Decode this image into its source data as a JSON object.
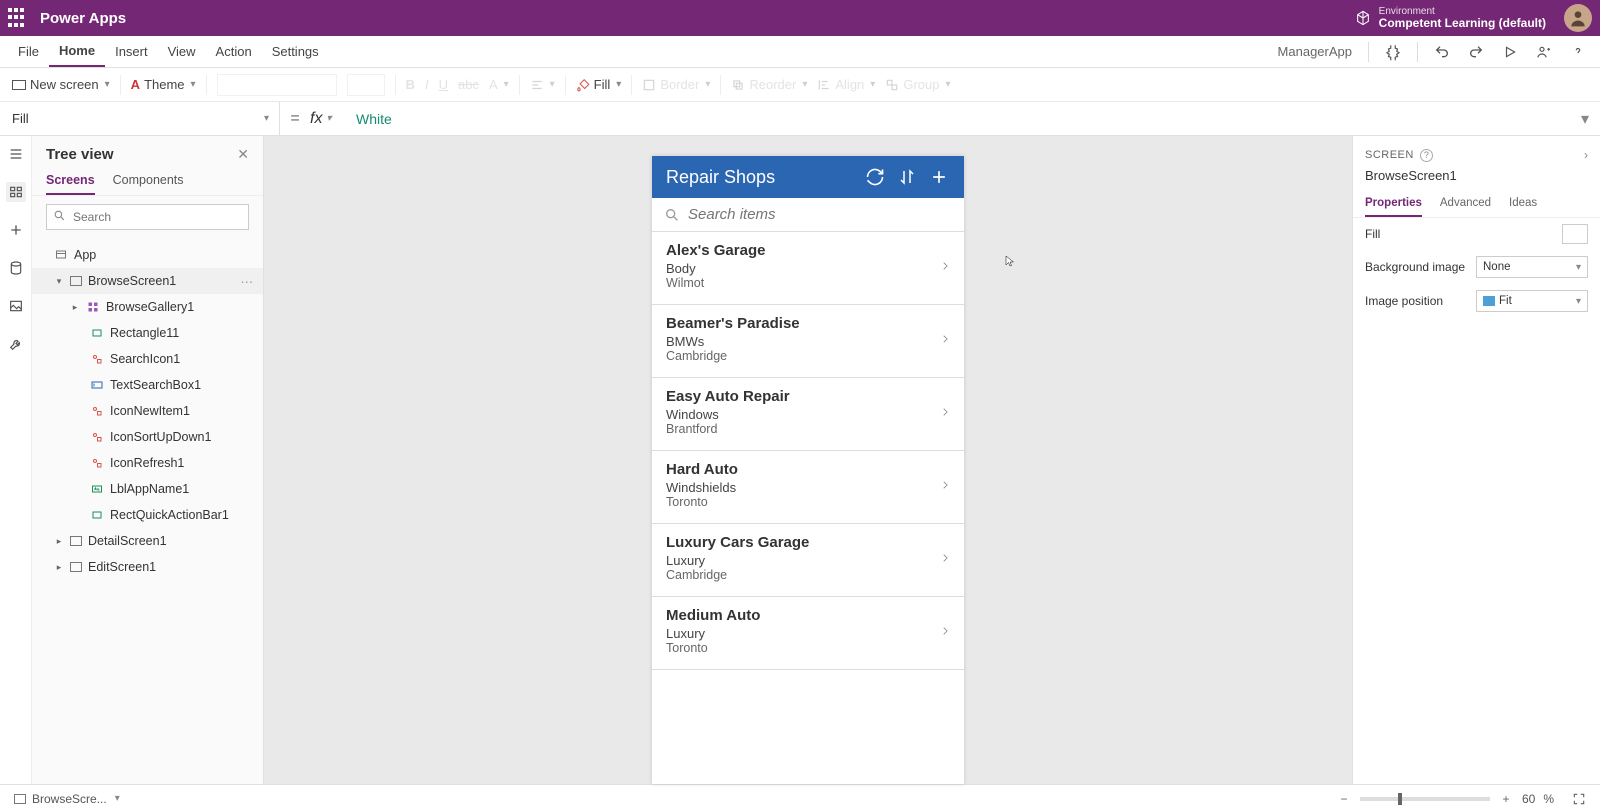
{
  "topbar": {
    "product": "Power Apps",
    "env_label": "Environment",
    "env_name": "Competent Learning (default)"
  },
  "menubar": {
    "items": [
      "File",
      "Home",
      "Insert",
      "View",
      "Action",
      "Settings"
    ],
    "active_index": 1,
    "app_name": "ManagerApp"
  },
  "toolbar": {
    "new_screen": "New screen",
    "theme": "Theme",
    "fill": "Fill",
    "border": "Border",
    "reorder": "Reorder",
    "align": "Align",
    "group": "Group"
  },
  "formula": {
    "property": "Fill",
    "value": "White"
  },
  "tree": {
    "title": "Tree view",
    "tabs": [
      "Screens",
      "Components"
    ],
    "active_tab": 0,
    "search_placeholder": "Search",
    "nodes": {
      "app": "App",
      "browse_screen": "BrowseScreen1",
      "gallery": "BrowseGallery1",
      "children": [
        "Rectangle11",
        "SearchIcon1",
        "TextSearchBox1",
        "IconNewItem1",
        "IconSortUpDown1",
        "IconRefresh1",
        "LblAppName1",
        "RectQuickActionBar1"
      ],
      "detail_screen": "DetailScreen1",
      "edit_screen": "EditScreen1"
    }
  },
  "canvas": {
    "header_title": "Repair Shops",
    "search_placeholder": "Search items",
    "items": [
      {
        "title": "Alex's Garage",
        "sub1": "Body",
        "sub2": "Wilmot"
      },
      {
        "title": "Beamer's Paradise",
        "sub1": "BMWs",
        "sub2": "Cambridge"
      },
      {
        "title": "Easy Auto Repair",
        "sub1": "Windows",
        "sub2": "Brantford"
      },
      {
        "title": "Hard Auto",
        "sub1": "Windshields",
        "sub2": "Toronto"
      },
      {
        "title": "Luxury Cars Garage",
        "sub1": "Luxury",
        "sub2": "Cambridge"
      },
      {
        "title": "Medium Auto",
        "sub1": "Luxury",
        "sub2": "Toronto"
      }
    ]
  },
  "props": {
    "section_label": "Screen",
    "entity_name": "BrowseScreen1",
    "tabs": [
      "Properties",
      "Advanced",
      "Ideas"
    ],
    "active_tab": 0,
    "rows": {
      "fill_label": "Fill",
      "bg_label": "Background image",
      "bg_value": "None",
      "pos_label": "Image position",
      "pos_value": "Fit"
    }
  },
  "statusbar": {
    "screen": "BrowseScre...",
    "zoom_pct": "60",
    "pct_sign": "%"
  }
}
